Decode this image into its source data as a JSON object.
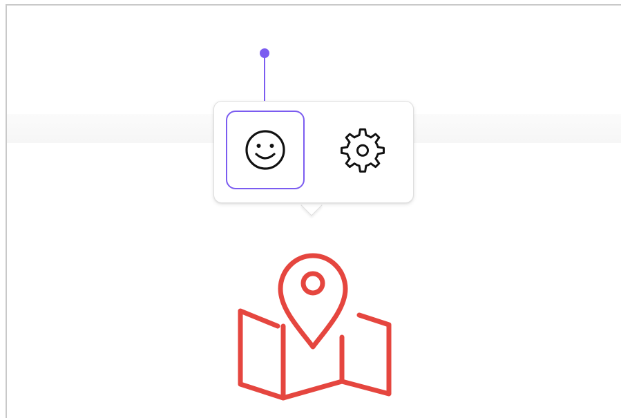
{
  "toolbar": {
    "items": [
      {
        "icon": "smiley-face-icon",
        "selected": true
      },
      {
        "icon": "gear-icon",
        "selected": false
      }
    ]
  },
  "canvas_object": {
    "icon": "map-pin-icon"
  },
  "colors": {
    "accent": "#7b5cf0",
    "map_icon": "#e5463f",
    "icon_stroke": "#111111",
    "frame": "#c9c9c9"
  }
}
